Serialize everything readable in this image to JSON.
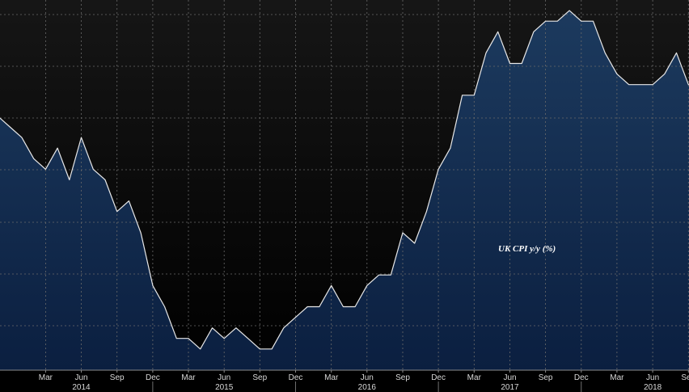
{
  "chart_data": {
    "type": "area",
    "title": "",
    "xlabel": "",
    "ylabel": "",
    "annotation": "UK CPI y/y (%)",
    "series": [
      {
        "x": [
          "2013-11",
          "2013-12",
          "2014-01",
          "2014-02",
          "2014-03",
          "2014-04",
          "2014-05",
          "2014-06",
          "2014-07",
          "2014-08",
          "2014-09",
          "2014-10",
          "2014-11",
          "2014-12",
          "2015-01",
          "2015-02",
          "2015-03",
          "2015-04",
          "2015-05",
          "2015-06",
          "2015-07",
          "2015-08",
          "2015-09",
          "2015-10",
          "2015-11",
          "2015-12",
          "2016-01",
          "2016-02",
          "2016-03",
          "2016-04",
          "2016-05",
          "2016-06",
          "2016-07",
          "2016-08",
          "2016-09",
          "2016-10",
          "2016-11",
          "2016-12",
          "2017-01",
          "2017-02",
          "2017-03",
          "2017-04",
          "2017-05",
          "2017-06",
          "2017-07",
          "2017-08",
          "2017-09",
          "2017-10",
          "2017-11",
          "2017-12",
          "2018-01",
          "2018-02",
          "2018-03",
          "2018-04",
          "2018-05",
          "2018-06",
          "2018-07",
          "2018-08",
          "2018-09",
          "2018-10"
        ],
        "values": [
          2.1,
          2.0,
          1.9,
          1.7,
          1.6,
          1.8,
          1.5,
          1.9,
          1.6,
          1.5,
          1.2,
          1.3,
          1.0,
          0.5,
          0.3,
          0.0,
          0.0,
          -0.1,
          0.1,
          0.0,
          0.1,
          0.0,
          -0.1,
          -0.1,
          0.1,
          0.2,
          0.3,
          0.3,
          0.5,
          0.3,
          0.3,
          0.5,
          0.6,
          0.6,
          1.0,
          0.9,
          1.2,
          1.6,
          1.8,
          2.3,
          2.3,
          2.7,
          2.9,
          2.6,
          2.6,
          2.9,
          3.0,
          3.0,
          3.1,
          3.0,
          3.0,
          2.7,
          2.5,
          2.4,
          2.4,
          2.4,
          2.5,
          2.7,
          2.4,
          2.4
        ]
      }
    ],
    "ylim": [
      -0.3,
      3.2
    ],
    "grid": true,
    "x_ticks": [
      "Mar",
      "Jun",
      "Sep",
      "Dec",
      "Mar",
      "Jun",
      "Sep",
      "Dec",
      "Mar",
      "Jun",
      "Sep",
      "Dec",
      "Mar",
      "Jun",
      "Sep",
      "Dec",
      "Mar",
      "Jun",
      "Sep"
    ],
    "x_tick_dates": [
      "2014-03",
      "2014-06",
      "2014-09",
      "2014-12",
      "2015-03",
      "2015-06",
      "2015-09",
      "2015-12",
      "2016-03",
      "2016-06",
      "2016-09",
      "2016-12",
      "2017-03",
      "2017-06",
      "2017-09",
      "2017-12",
      "2018-03",
      "2018-06",
      "2018-09"
    ],
    "year_labels": [
      {
        "label": "2014",
        "center": "2014-06"
      },
      {
        "label": "2015",
        "center": "2015-06"
      },
      {
        "label": "2016",
        "center": "2016-06"
      },
      {
        "label": "2017",
        "center": "2017-06"
      },
      {
        "label": "2018",
        "center": "2018-06"
      }
    ],
    "year_dividers": [
      "2014-12",
      "2015-12",
      "2016-12",
      "2017-12"
    ],
    "colors": {
      "background_top": "#161616",
      "background_bottom": "#000000",
      "area_top": "#1c3a5e",
      "area_bottom": "#0b1f40",
      "line": "#e8e8e8",
      "grid": "#6a6a6a",
      "text": "#d8d8d8"
    }
  }
}
